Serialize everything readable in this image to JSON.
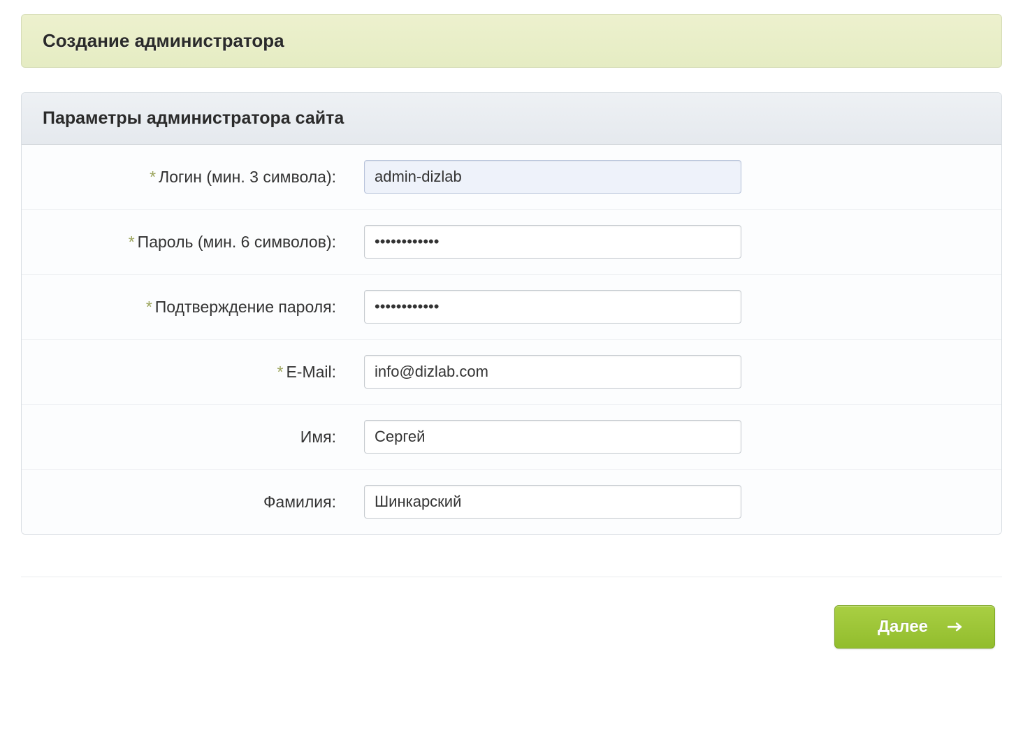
{
  "header": {
    "title": "Создание администратора"
  },
  "panel": {
    "title": "Параметры администратора сайта"
  },
  "fields": {
    "login": {
      "label": "Логин (мин. 3 символа):",
      "value": "admin-dizlab",
      "required": true
    },
    "password": {
      "label": "Пароль (мин. 6 символов):",
      "value": "••••••••••••",
      "required": true
    },
    "password_confirm": {
      "label": "Подтверждение пароля:",
      "value": "••••••••••••",
      "required": true
    },
    "email": {
      "label": "E-Mail:",
      "value": "info@dizlab.com",
      "required": true
    },
    "first_name": {
      "label": "Имя:",
      "value": "Сергей",
      "required": false
    },
    "last_name": {
      "label": "Фамилия:",
      "value": "Шинкарский",
      "required": false
    }
  },
  "actions": {
    "next_label": "Далее"
  },
  "required_marker": "*"
}
